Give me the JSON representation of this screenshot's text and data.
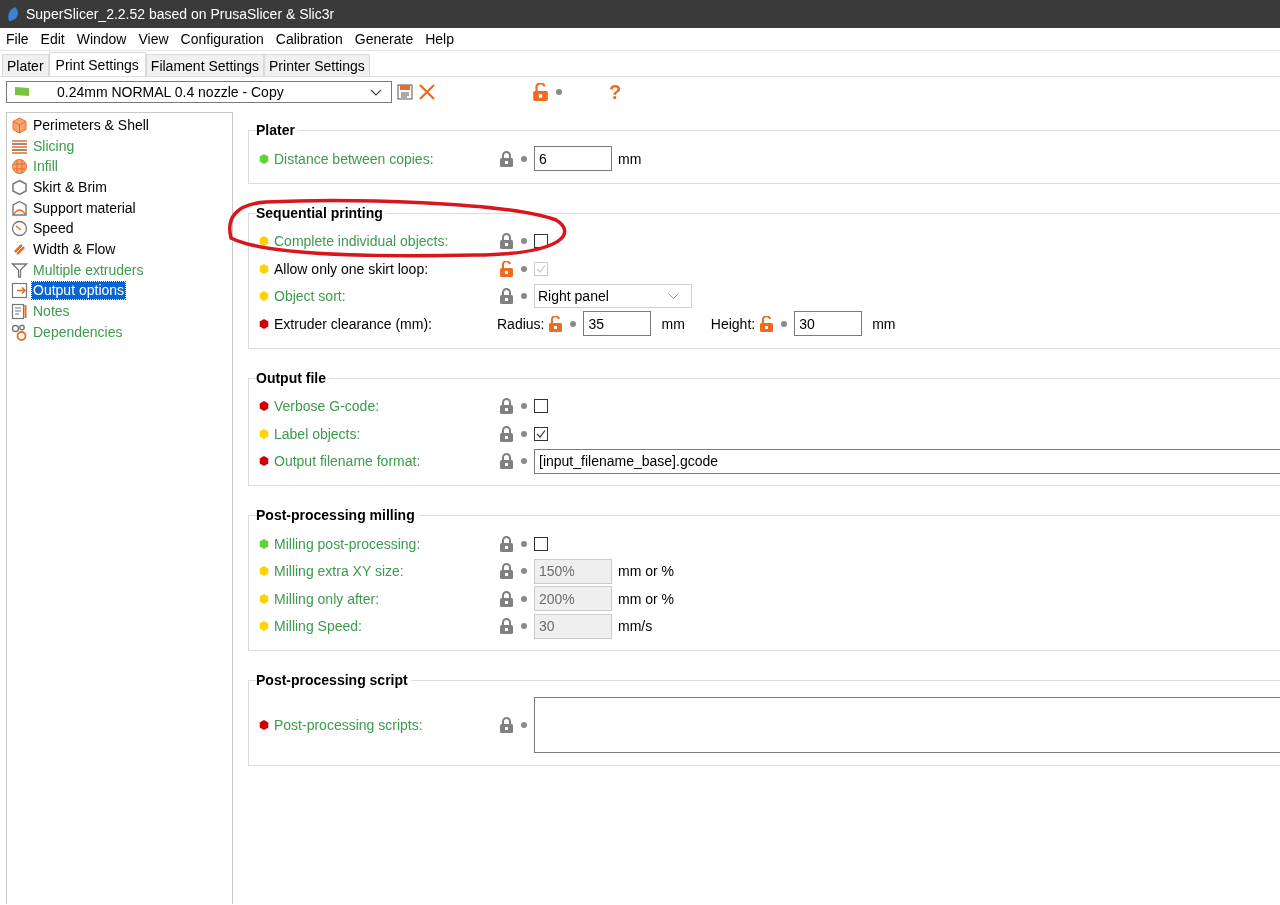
{
  "window": {
    "title": "SuperSlicer_2.2.52 based on PrusaSlicer & Slic3r"
  },
  "menu": [
    "File",
    "Edit",
    "Window",
    "View",
    "Configuration",
    "Calibration",
    "Generate",
    "Help"
  ],
  "tabs": [
    {
      "label": "Plater",
      "selected": false
    },
    {
      "label": "Print Settings",
      "selected": true
    },
    {
      "label": "Filament Settings",
      "selected": false
    },
    {
      "label": "Printer Settings",
      "selected": false
    }
  ],
  "preset": {
    "value": "0.24mm NORMAL 0.4 nozzle - Copy",
    "locked": false,
    "help": "?"
  },
  "sidebar": {
    "items": [
      {
        "label": "Perimeters & Shell",
        "system_value": false,
        "selected": false
      },
      {
        "label": "Slicing",
        "system_value": true,
        "selected": false
      },
      {
        "label": "Infill",
        "system_value": true,
        "selected": false
      },
      {
        "label": "Skirt & Brim",
        "system_value": false,
        "selected": false
      },
      {
        "label": "Support material",
        "system_value": false,
        "selected": false
      },
      {
        "label": "Speed",
        "system_value": false,
        "selected": false
      },
      {
        "label": "Width & Flow",
        "system_value": false,
        "selected": false
      },
      {
        "label": "Multiple extruders",
        "system_value": true,
        "selected": false
      },
      {
        "label": "Output options",
        "selected": true
      },
      {
        "label": "Notes",
        "system_value": true,
        "selected": false
      },
      {
        "label": "Dependencies",
        "system_value": true,
        "selected": false
      }
    ]
  },
  "sections": [
    {
      "title": "Plater",
      "rows": [
        {
          "kind": "input",
          "label": "Distance between copies:",
          "system_value": true,
          "color": "#5fd334",
          "locked": true,
          "value": "6",
          "unit": "mm",
          "disabled": false
        }
      ]
    },
    {
      "title": "Sequential printing",
      "rows": [
        {
          "kind": "checkbox",
          "label": "Complete individual objects:",
          "system_value": true,
          "color": "#ffd200",
          "locked": true,
          "checked": false,
          "disabled": false
        },
        {
          "kind": "checkbox",
          "label": "Allow only one skirt loop:",
          "system_value": false,
          "color": "#ffd200",
          "locked": false,
          "checked": true,
          "disabled": true
        },
        {
          "kind": "select",
          "label": "Object sort:",
          "system_value": true,
          "color": "#ffd200",
          "locked": true,
          "value": "Right panel"
        },
        {
          "kind": "clearance",
          "label": "Extruder clearance (mm):",
          "system_value": false,
          "color": "#d00000",
          "fields": [
            {
              "label": "Radius:",
              "locked": false,
              "value": "35",
              "unit": "mm"
            },
            {
              "label": "Height:",
              "locked": false,
              "value": "30",
              "unit": "mm"
            }
          ]
        }
      ]
    },
    {
      "title": "Output file",
      "rows": [
        {
          "kind": "checkbox",
          "label": "Verbose G-code:",
          "system_value": true,
          "color": "#d00000",
          "locked": true,
          "checked": false,
          "disabled": false
        },
        {
          "kind": "checkbox",
          "label": "Label objects:",
          "system_value": true,
          "color": "#ffd200",
          "locked": true,
          "checked": true,
          "disabled": false
        },
        {
          "kind": "wide",
          "label": "Output filename format:",
          "system_value": true,
          "color": "#d00000",
          "locked": true,
          "value": "[input_filename_base].gcode"
        }
      ]
    },
    {
      "title": "Post-processing milling",
      "rows": [
        {
          "kind": "checkbox",
          "label": "Milling post-processing:",
          "system_value": true,
          "color": "#5fd334",
          "locked": true,
          "checked": false,
          "disabled": false
        },
        {
          "kind": "input",
          "label": "Milling extra XY size:",
          "system_value": true,
          "color": "#ffd200",
          "locked": true,
          "value": "150%",
          "unit": "mm or %",
          "disabled": true
        },
        {
          "kind": "input",
          "label": "Milling only after:",
          "system_value": true,
          "color": "#ffd200",
          "locked": true,
          "value": "200%",
          "unit": "mm or %",
          "disabled": true
        },
        {
          "kind": "input",
          "label": "Milling Speed:",
          "system_value": true,
          "color": "#ffd200",
          "locked": true,
          "value": "30",
          "unit": "mm/s",
          "disabled": true
        }
      ]
    },
    {
      "title": "Post-processing script",
      "rows": [
        {
          "kind": "textarea",
          "label": "Post-processing scripts:",
          "system_value": true,
          "color": "#d00000",
          "locked": true
        }
      ]
    }
  ]
}
